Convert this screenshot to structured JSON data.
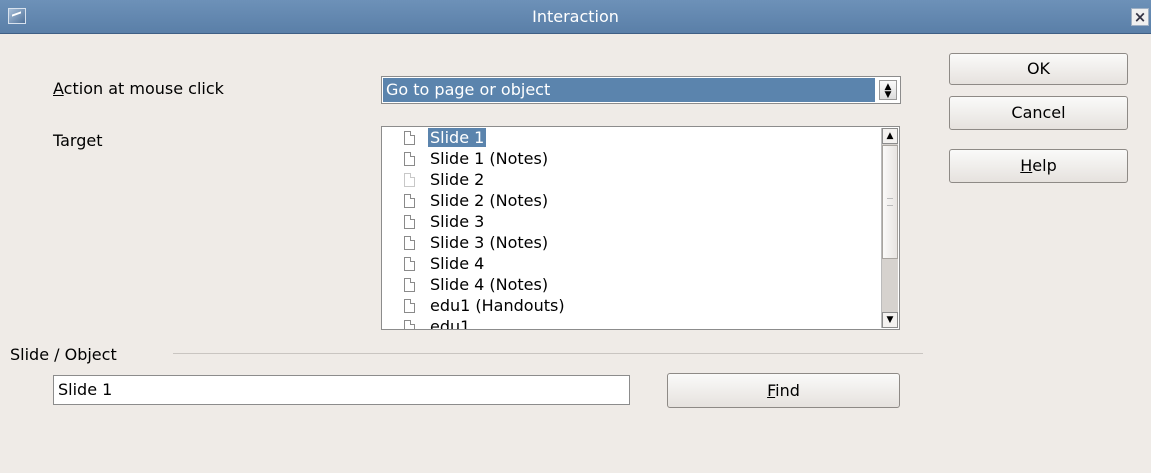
{
  "window": {
    "title": "Interaction"
  },
  "form": {
    "action_label": "Action at mouse click",
    "action_value": "Go to page or object",
    "target_label": "Target",
    "target_items": [
      {
        "label": "Slide 1",
        "selected": true,
        "faint": false
      },
      {
        "label": "Slide 1 (Notes)",
        "selected": false,
        "faint": false
      },
      {
        "label": "Slide 2",
        "selected": false,
        "faint": true
      },
      {
        "label": "Slide 2 (Notes)",
        "selected": false,
        "faint": false
      },
      {
        "label": "Slide 3",
        "selected": false,
        "faint": false
      },
      {
        "label": "Slide 3 (Notes)",
        "selected": false,
        "faint": false
      },
      {
        "label": "Slide 4",
        "selected": false,
        "faint": false
      },
      {
        "label": "Slide 4 (Notes)",
        "selected": false,
        "faint": false
      },
      {
        "label": "edu1 (Handouts)",
        "selected": false,
        "faint": false
      },
      {
        "label": "edu1",
        "selected": false,
        "faint": false
      }
    ],
    "group_label": "Slide / Object",
    "object_value": "Slide 1",
    "find_label": "Find"
  },
  "buttons": {
    "ok": "OK",
    "cancel": "Cancel",
    "help": "Help"
  },
  "colors": {
    "titlebar": "#5f84ad",
    "selection": "#5b84ad",
    "dialog_bg": "#efebe7"
  },
  "icons": {
    "item_icon": "document-icon",
    "app_icon": "window-app-icon"
  }
}
